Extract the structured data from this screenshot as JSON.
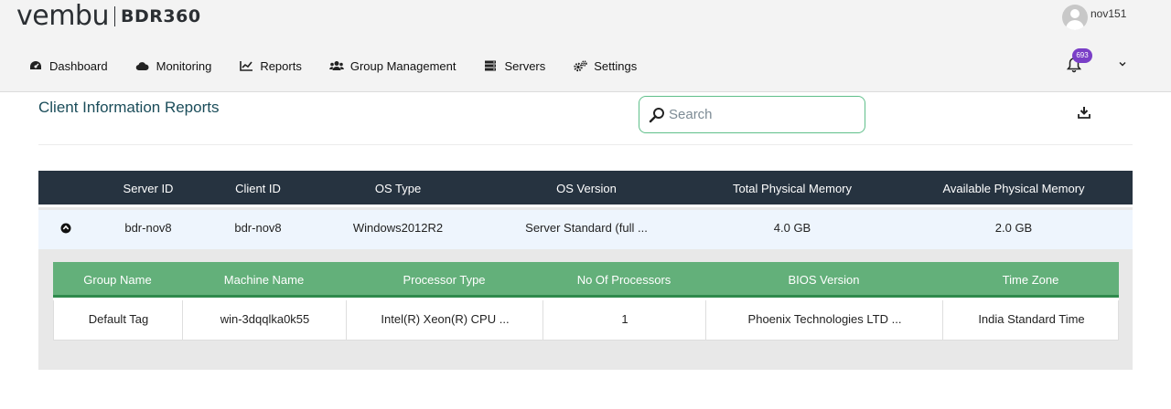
{
  "brand": {
    "logo_word": "vembu",
    "product": "BDR360"
  },
  "user": {
    "name": "nov151"
  },
  "nav": {
    "items": [
      {
        "label": "Dashboard",
        "icon": "dashboard-icon"
      },
      {
        "label": "Monitoring",
        "icon": "cloud-icon"
      },
      {
        "label": "Reports",
        "icon": "line-chart-icon"
      },
      {
        "label": "Group Management",
        "icon": "users-icon"
      },
      {
        "label": "Servers",
        "icon": "server-icon"
      },
      {
        "label": "Settings",
        "icon": "gears-icon"
      }
    ],
    "notification_count": "693"
  },
  "page": {
    "title": "Client Information Reports",
    "search_placeholder": "Search"
  },
  "main_table": {
    "columns": [
      "Server ID",
      "Client ID",
      "OS Type",
      "OS Version",
      "Total Physical Memory",
      "Available Physical Memory"
    ],
    "rows": [
      [
        "bdr-nov8",
        "bdr-nov8",
        "Windows2012R2",
        "Server Standard (full ...",
        "4.0 GB",
        "2.0 GB"
      ]
    ]
  },
  "detail_table": {
    "columns": [
      "Group Name",
      "Machine Name",
      "Processor Type",
      "No Of Processors",
      "BIOS Version",
      "Time Zone"
    ],
    "rows": [
      [
        "Default Tag",
        "win-3dqqlka0k55",
        "Intel(R) Xeon(R) CPU ...",
        "1",
        "Phoenix Technologies LTD ...",
        "India Standard Time"
      ]
    ]
  },
  "colors": {
    "header_bg": "#f3f3f3",
    "table_header_bg": "#263340",
    "detail_header_bg": "#63b07a",
    "accent_green": "#5fbf8a",
    "badge_purple": "#7a3fc7",
    "title_color": "#1b4d5a"
  }
}
